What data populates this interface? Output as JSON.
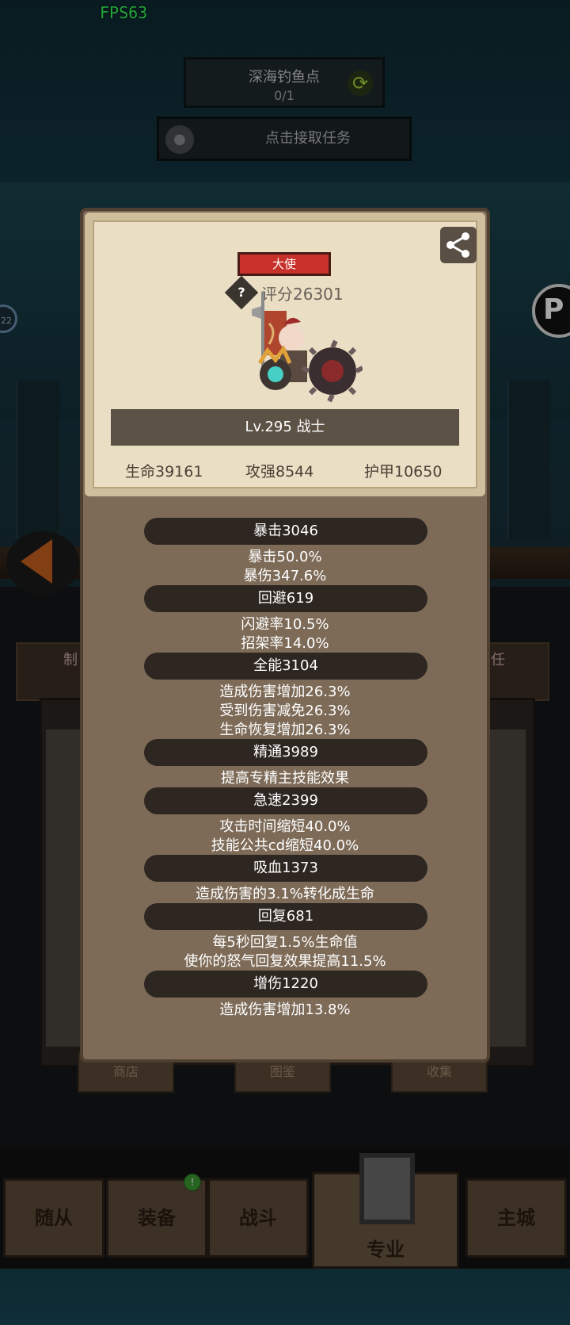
{
  "fps": "FPS63",
  "task": {
    "name": "深海钓鱼点",
    "progress": "0/1",
    "accept_label": "点击接取任务"
  },
  "background": {
    "side_badge": "22",
    "side_letter": "P",
    "tabs": [
      "制",
      "任"
    ],
    "buttons": [
      "商店",
      "图鉴",
      "收集"
    ]
  },
  "nav": {
    "items": [
      "随从",
      "装备",
      "战斗",
      "专业",
      "主城"
    ],
    "active": "专业",
    "badge": "!"
  },
  "card": {
    "title_badge": "大使",
    "score": "评分26301",
    "level": "Lv.295 战士",
    "base_stats": {
      "hp": "生命39161",
      "attack": "攻强8544",
      "armor": "护甲10650"
    }
  },
  "stats": [
    {
      "head": "暴击3046",
      "lines": [
        "暴击50.0%",
        "暴伤347.6%"
      ]
    },
    {
      "head": "回避619",
      "lines": [
        "闪避率10.5%",
        "招架率14.0%"
      ]
    },
    {
      "head": "全能3104",
      "lines": [
        "造成伤害增加26.3%",
        "受到伤害减免26.3%",
        "生命恢复增加26.3%"
      ]
    },
    {
      "head": "精通3989",
      "lines": [
        "提高专精主技能效果"
      ]
    },
    {
      "head": "急速2399",
      "lines": [
        "攻击时间缩短40.0%",
        "技能公共cd缩短40.0%"
      ]
    },
    {
      "head": "吸血1373",
      "lines": [
        "造成伤害的3.1%转化成生命"
      ]
    },
    {
      "head": "回复681",
      "lines": [
        "每5秒回复1.5%生命值",
        "使你的怒气回复效果提高11.5%"
      ]
    },
    {
      "head": "增伤1220",
      "lines": [
        "造成伤害增加13.8%"
      ]
    }
  ],
  "colors": {
    "badge_red": "#c8312a",
    "panel": "#7d6b58",
    "card": "#eadfc4",
    "fps_green": "#37ff5a"
  }
}
